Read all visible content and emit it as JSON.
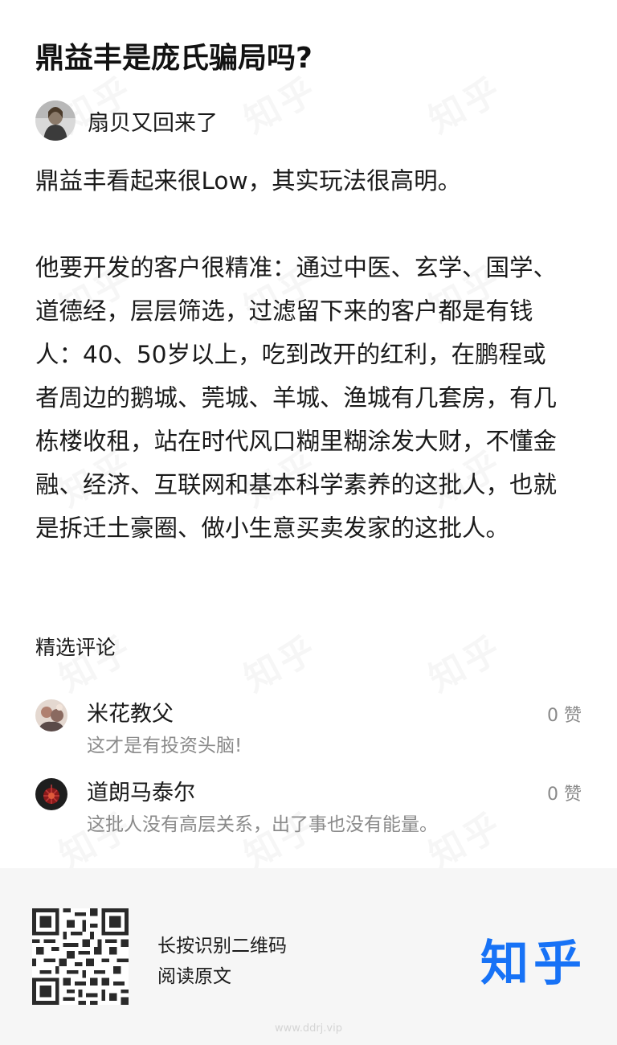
{
  "question": {
    "title": "鼎益丰是庞氏骗局吗?"
  },
  "author": {
    "name": "扇贝又回来了"
  },
  "answer": {
    "paragraphs": [
      "鼎益丰看起来很Low，其实玩法很高明。",
      "他要开发的客户很精准：通过中医、玄学、国学、道德经，层层筛选，过滤留下来的客户都是有钱人：40、50岁以上，吃到改开的红利，在鹏程或者周边的鹅城、莞城、羊城、渔城有几套房，有几栋楼收租，站在时代风口糊里糊涂发大财，不懂金融、经济、互联网和基本科学素养的这批人，也就是拆迁土豪圈、做小生意买卖发家的这批人。"
    ]
  },
  "comments": {
    "section_title": "精选评论",
    "items": [
      {
        "name": "米花教父",
        "text": "这才是有投资头脑!",
        "likes": "0 赞"
      },
      {
        "name": "道朗马泰尔",
        "text": "这批人没有高层关系，出了事也没有能量。",
        "likes": "0 赞"
      }
    ]
  },
  "footer": {
    "line1": "长按识别二维码",
    "line2": "阅读原文",
    "logo": "知乎",
    "site": "www.ddrj.vip"
  },
  "watermark": "知乎",
  "colors": {
    "brand": "#1772f6",
    "muted": "#8a8a8a",
    "footer_bg": "#f6f6f6"
  }
}
